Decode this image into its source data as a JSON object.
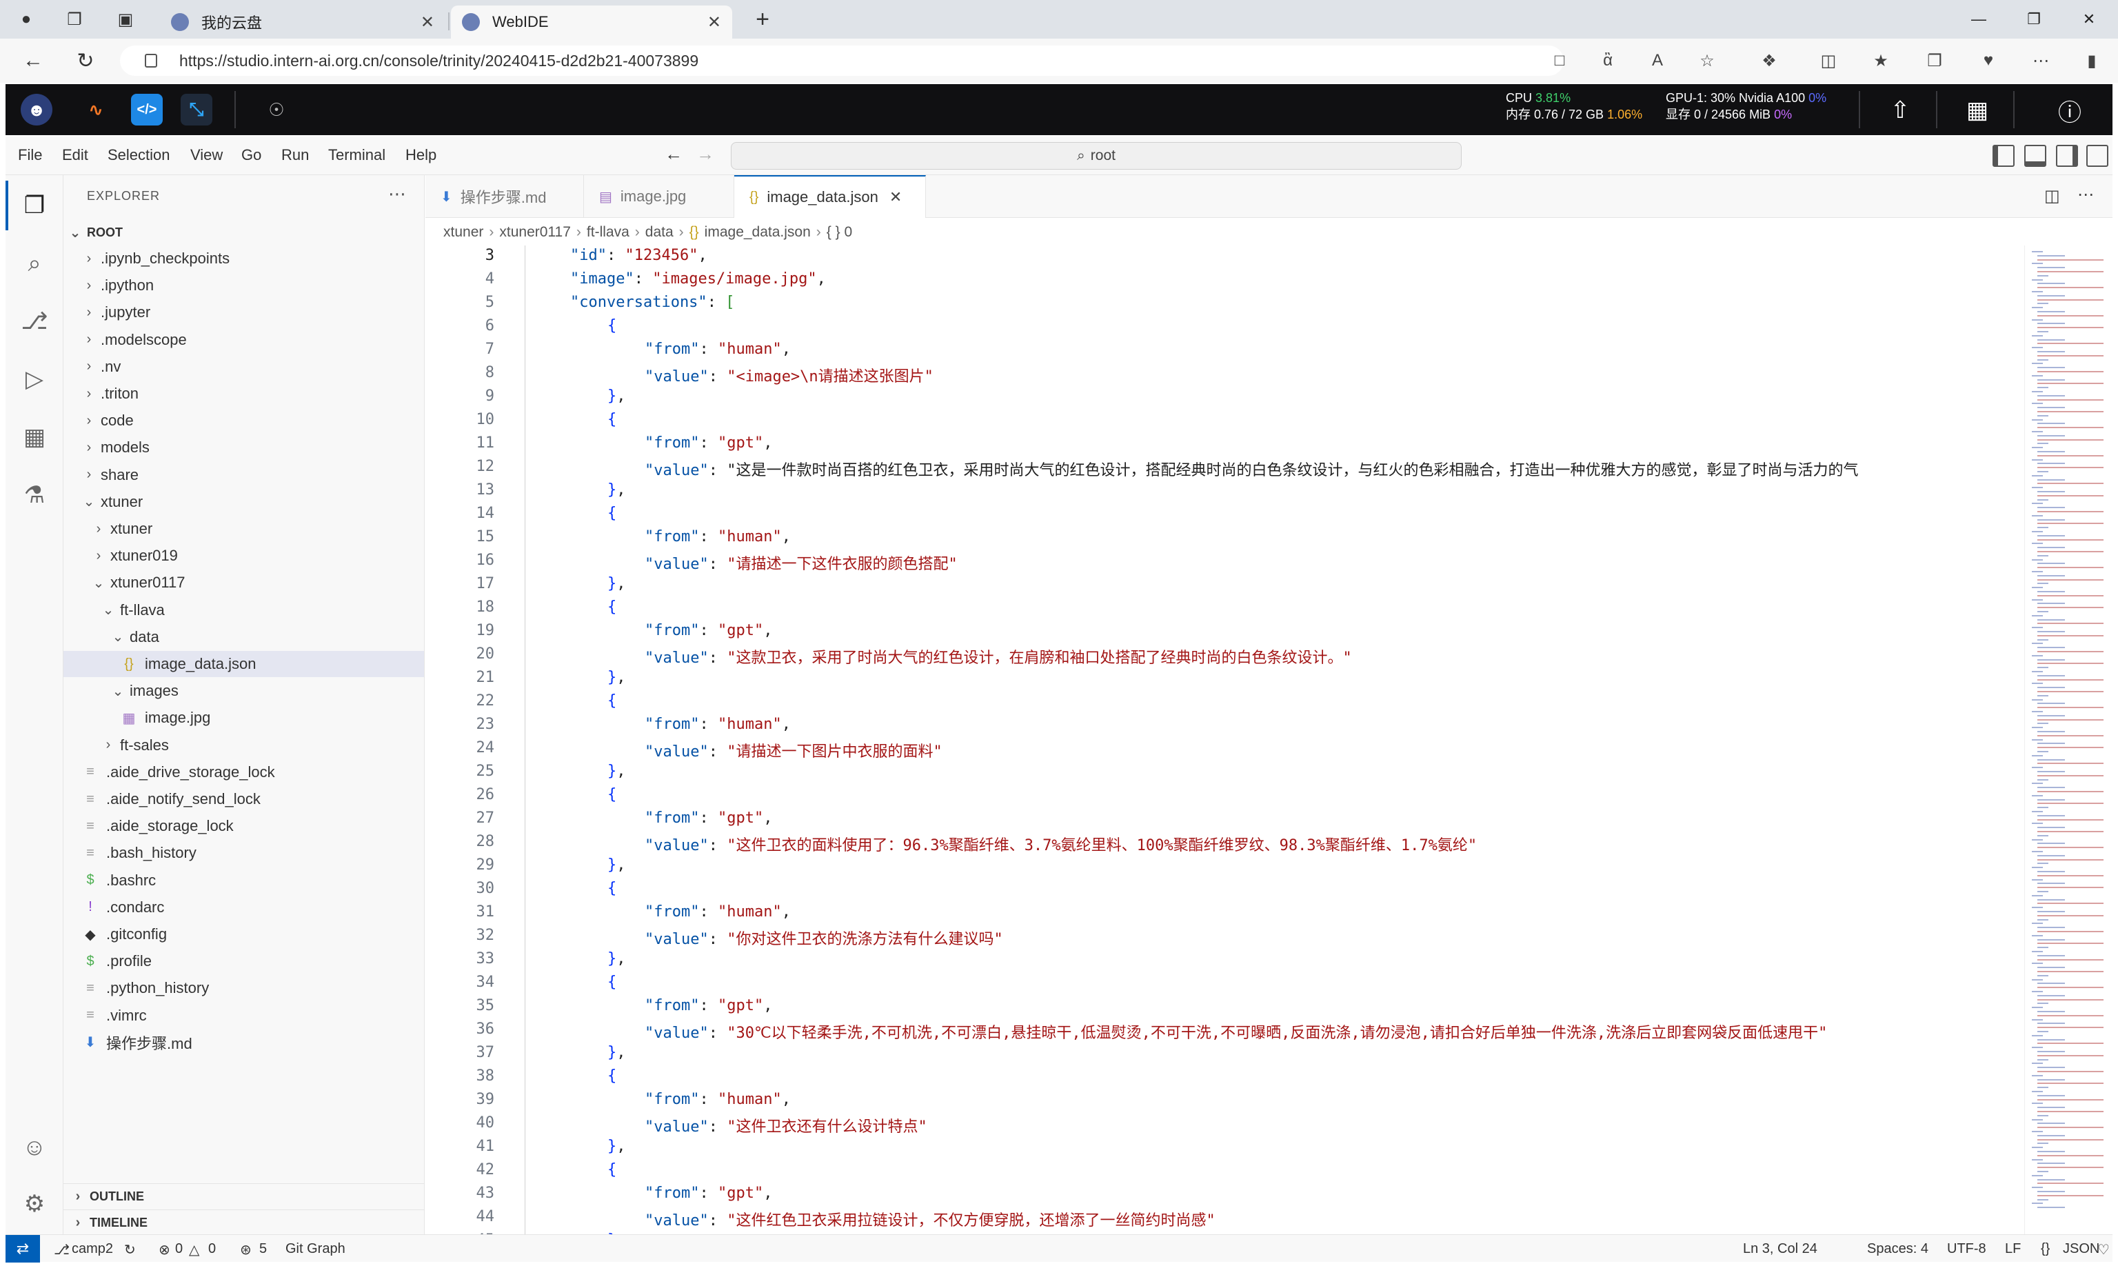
{
  "browser": {
    "tabs": [
      {
        "title": "我的云盘",
        "active": false
      },
      {
        "title": "WebIDE",
        "active": true
      }
    ],
    "url": "https://studio.intern-ai.org.cn/console/trinity/20240415-d2d2b21-40073899"
  },
  "header": {
    "cpu_label": "CPU",
    "cpu_value": "3.81%",
    "mem_label": "内存 0.76 / 72 GB",
    "mem_value": "1.06%",
    "gpu_label": "GPU-1: 30% Nvidia A100",
    "gpu_value": "0%",
    "vram_label": "显存 0 / 24566 MiB",
    "vram_value": "0%"
  },
  "menubar": {
    "items": [
      "File",
      "Edit",
      "Selection",
      "View",
      "Go",
      "Run",
      "Terminal",
      "Help"
    ],
    "command_center": "root"
  },
  "sidebar": {
    "title": "EXPLORER",
    "root": "ROOT",
    "tree": [
      {
        "label": ".ipynb_checkpoints",
        "depth": 1,
        "kind": "folder",
        "open": false
      },
      {
        "label": ".ipython",
        "depth": 1,
        "kind": "folder",
        "open": false
      },
      {
        "label": ".jupyter",
        "depth": 1,
        "kind": "folder",
        "open": false
      },
      {
        "label": ".modelscope",
        "depth": 1,
        "kind": "folder",
        "open": false
      },
      {
        "label": ".nv",
        "depth": 1,
        "kind": "folder",
        "open": false
      },
      {
        "label": ".triton",
        "depth": 1,
        "kind": "folder",
        "open": false
      },
      {
        "label": "code",
        "depth": 1,
        "kind": "folder",
        "open": false
      },
      {
        "label": "models",
        "depth": 1,
        "kind": "folder",
        "open": false
      },
      {
        "label": "share",
        "depth": 1,
        "kind": "folder",
        "open": false
      },
      {
        "label": "xtuner",
        "depth": 1,
        "kind": "folder",
        "open": true
      },
      {
        "label": "xtuner",
        "depth": 2,
        "kind": "folder",
        "open": false
      },
      {
        "label": "xtuner019",
        "depth": 2,
        "kind": "folder",
        "open": false
      },
      {
        "label": "xtuner0117",
        "depth": 2,
        "kind": "folder",
        "open": true
      },
      {
        "label": "ft-llava",
        "depth": 3,
        "kind": "folder",
        "open": true
      },
      {
        "label": "data",
        "depth": 4,
        "kind": "folder",
        "open": true
      },
      {
        "label": "image_data.json",
        "depth": 5,
        "kind": "json",
        "selected": true
      },
      {
        "label": "images",
        "depth": 4,
        "kind": "folder",
        "open": true
      },
      {
        "label": "image.jpg",
        "depth": 5,
        "kind": "image"
      },
      {
        "label": "ft-sales",
        "depth": 3,
        "kind": "folder",
        "open": false
      },
      {
        "label": ".aide_drive_storage_lock",
        "depth": 1,
        "kind": "file"
      },
      {
        "label": ".aide_notify_send_lock",
        "depth": 1,
        "kind": "file"
      },
      {
        "label": ".aide_storage_lock",
        "depth": 1,
        "kind": "file"
      },
      {
        "label": ".bash_history",
        "depth": 1,
        "kind": "file"
      },
      {
        "label": ".bashrc",
        "depth": 1,
        "kind": "shell"
      },
      {
        "label": ".condarc",
        "depth": 1,
        "kind": "excl"
      },
      {
        "label": ".gitconfig",
        "depth": 1,
        "kind": "git"
      },
      {
        "label": ".profile",
        "depth": 1,
        "kind": "shell"
      },
      {
        "label": ".python_history",
        "depth": 1,
        "kind": "file"
      },
      {
        "label": ".vimrc",
        "depth": 1,
        "kind": "file"
      },
      {
        "label": "操作步骤.md",
        "depth": 1,
        "kind": "md"
      }
    ],
    "sections": [
      "OUTLINE",
      "TIMELINE"
    ]
  },
  "editor": {
    "tabs": [
      {
        "label": "操作步骤.md",
        "icon": "md",
        "active": false
      },
      {
        "label": "image.jpg",
        "icon": "image",
        "active": false
      },
      {
        "label": "image_data.json",
        "icon": "json",
        "active": true
      }
    ],
    "breadcrumb": [
      "xtuner",
      "xtuner0117",
      "ft-llava",
      "data",
      "image_data.json",
      "{ } 0"
    ],
    "lines": [
      {
        "n": "3",
        "i": 0,
        "t": "\"id\": \"123456\","
      },
      {
        "n": "4",
        "i": 0,
        "t": "\"image\": \"images/image.jpg\","
      },
      {
        "n": "5",
        "i": 0,
        "t": "\"conversations\": ["
      },
      {
        "n": "6",
        "i": 1,
        "t": "{"
      },
      {
        "n": "7",
        "i": 2,
        "t": "\"from\": \"human\","
      },
      {
        "n": "8",
        "i": 2,
        "t": "\"value\": \"<image>\\n请描述这张图片\""
      },
      {
        "n": "9",
        "i": 1,
        "t": "},"
      },
      {
        "n": "10",
        "i": 1,
        "t": "{"
      },
      {
        "n": "11",
        "i": 2,
        "t": "\"from\": \"gpt\","
      },
      {
        "n": "12",
        "i": 2,
        "t": "\"value\": \"这是一件款时尚百搭的红色卫衣，采用时尚大气的红色设计，搭配经典时尚的白色条纹设计，与红火的色彩相融合，打造出一种优雅大方的感觉，彰显了时尚与活力的气"
      },
      {
        "n": "13",
        "i": 1,
        "t": "},"
      },
      {
        "n": "14",
        "i": 1,
        "t": "{"
      },
      {
        "n": "15",
        "i": 2,
        "t": "\"from\": \"human\","
      },
      {
        "n": "16",
        "i": 2,
        "t": "\"value\": \"请描述一下这件衣服的颜色搭配\""
      },
      {
        "n": "17",
        "i": 1,
        "t": "},"
      },
      {
        "n": "18",
        "i": 1,
        "t": "{"
      },
      {
        "n": "19",
        "i": 2,
        "t": "\"from\": \"gpt\","
      },
      {
        "n": "20",
        "i": 2,
        "t": "\"value\": \"这款卫衣，采用了时尚大气的红色设计，在肩膀和袖口处搭配了经典时尚的白色条纹设计。\""
      },
      {
        "n": "21",
        "i": 1,
        "t": "},"
      },
      {
        "n": "22",
        "i": 1,
        "t": "{"
      },
      {
        "n": "23",
        "i": 2,
        "t": "\"from\": \"human\","
      },
      {
        "n": "24",
        "i": 2,
        "t": "\"value\": \"请描述一下图片中衣服的面料\""
      },
      {
        "n": "25",
        "i": 1,
        "t": "},"
      },
      {
        "n": "26",
        "i": 1,
        "t": "{"
      },
      {
        "n": "27",
        "i": 2,
        "t": "\"from\": \"gpt\","
      },
      {
        "n": "28",
        "i": 2,
        "t": "\"value\": \"这件卫衣的面料使用了：96.3%聚酯纤维、3.7%氨纶里料、100%聚酯纤维罗纹、98.3%聚酯纤维、1.7%氨纶\""
      },
      {
        "n": "29",
        "i": 1,
        "t": "},"
      },
      {
        "n": "30",
        "i": 1,
        "t": "{"
      },
      {
        "n": "31",
        "i": 2,
        "t": "\"from\": \"human\","
      },
      {
        "n": "32",
        "i": 2,
        "t": "\"value\": \"你对这件卫衣的洗涤方法有什么建议吗\""
      },
      {
        "n": "33",
        "i": 1,
        "t": "},"
      },
      {
        "n": "34",
        "i": 1,
        "t": "{"
      },
      {
        "n": "35",
        "i": 2,
        "t": "\"from\": \"gpt\","
      },
      {
        "n": "36",
        "i": 2,
        "t": "\"value\": \"30℃以下轻柔手洗,不可机洗,不可漂白,悬挂晾干,低温熨烫,不可干洗,不可曝晒,反面洗涤,请勿浸泡,请扣合好后单独一件洗涤,洗涤后立即套网袋反面低速甩干\""
      },
      {
        "n": "37",
        "i": 1,
        "t": "},"
      },
      {
        "n": "38",
        "i": 1,
        "t": "{"
      },
      {
        "n": "39",
        "i": 2,
        "t": "\"from\": \"human\","
      },
      {
        "n": "40",
        "i": 2,
        "t": "\"value\": \"这件卫衣还有什么设计特点\""
      },
      {
        "n": "41",
        "i": 1,
        "t": "},"
      },
      {
        "n": "42",
        "i": 1,
        "t": "{"
      },
      {
        "n": "43",
        "i": 2,
        "t": "\"from\": \"gpt\","
      },
      {
        "n": "44",
        "i": 2,
        "t": "\"value\": \"这件红色卫衣采用拉链设计，不仅方便穿脱，还增添了一丝简约时尚感\""
      },
      {
        "n": "45",
        "i": 1,
        "t": "},"
      }
    ]
  },
  "statusbar": {
    "branch": "camp2",
    "errors": "0",
    "warnings": "0",
    "ports": "5",
    "git_graph": "Git Graph",
    "cursor": "Ln 3, Col 24",
    "spaces": "Spaces: 4",
    "encoding": "UTF-8",
    "eol": "LF",
    "language": "JSON"
  }
}
